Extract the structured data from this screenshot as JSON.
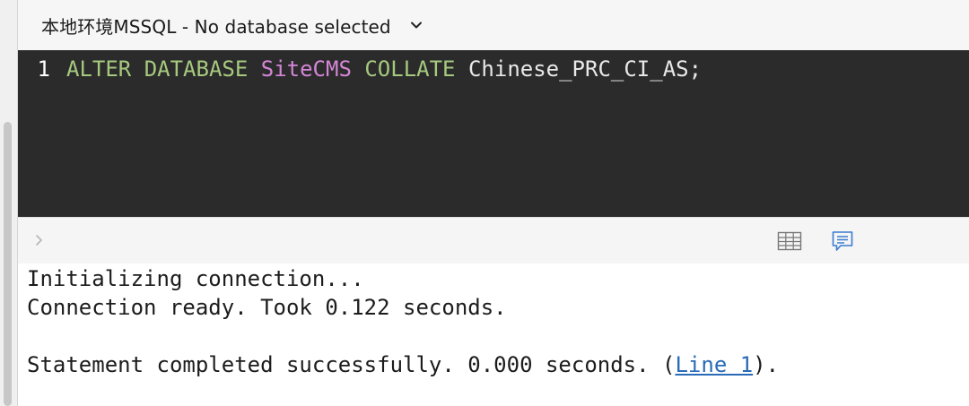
{
  "connection": {
    "title": "本地环境MSSQL - No database selected"
  },
  "editor": {
    "line_number": "1",
    "tokens": {
      "kw1": "ALTER DATABASE",
      "space1": " ",
      "ident": "SiteCMS",
      "space2": " ",
      "kw2": "COLLATE",
      "rest": " Chinese_PRC_CI_AS;"
    }
  },
  "output": {
    "line1": "Initializing connection...",
    "line2": "Connection ready. Took 0.122 seconds.",
    "line3_prefix": "Statement completed successfully. 0.000 seconds. (",
    "line3_link": "Line 1",
    "line3_suffix": ")."
  },
  "icons": {
    "chevron": "chevron-down-icon",
    "expand": "chevron-right-icon",
    "grid": "table-grid-icon",
    "messages": "message-icon"
  },
  "colors": {
    "editor_bg": "#2b2b2b",
    "keyword": "#a6c97f",
    "identifier": "#d386d6",
    "link": "#2a6bb8"
  }
}
